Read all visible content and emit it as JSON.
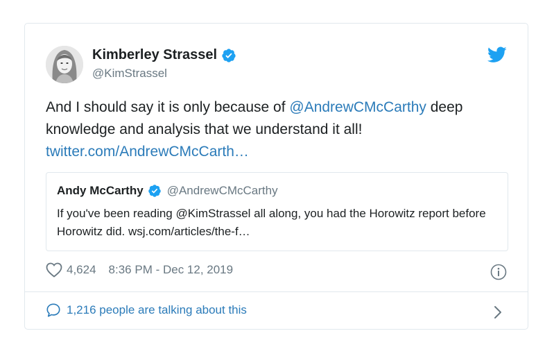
{
  "author": {
    "name": "Kimberley Strassel",
    "handle": "@KimStrassel",
    "verified": true
  },
  "tweet": {
    "text_before_mention": "And I should say it is only because of ",
    "mention": "@AndrewCMcCarthy",
    "text_after_mention": " deep knowledge and analysis that we understand it all!",
    "link": "twitter.com/AndrewCMcCarth…"
  },
  "quoted": {
    "name": "Andy McCarthy",
    "handle": "@AndrewCMcCarthy",
    "verified": true,
    "text": "If you've been reading @KimStrassel all along, you had the Horowitz report before Horowitz did.  wsj.com/articles/the-f…"
  },
  "meta": {
    "likes": "4,624",
    "timestamp": "8:36 PM - Dec 12, 2019"
  },
  "footer": {
    "talking": "1,216 people are talking about this"
  },
  "colors": {
    "link": "#2b7bb9",
    "verified": "#1da1f2",
    "twitter_bird": "#1da1f2",
    "muted": "#697882",
    "border": "#e1e8ed"
  },
  "icons": [
    "verified-badge-icon",
    "twitter-bird-icon",
    "heart-icon",
    "info-icon",
    "speech-bubble-icon",
    "chevron-right-icon"
  ]
}
